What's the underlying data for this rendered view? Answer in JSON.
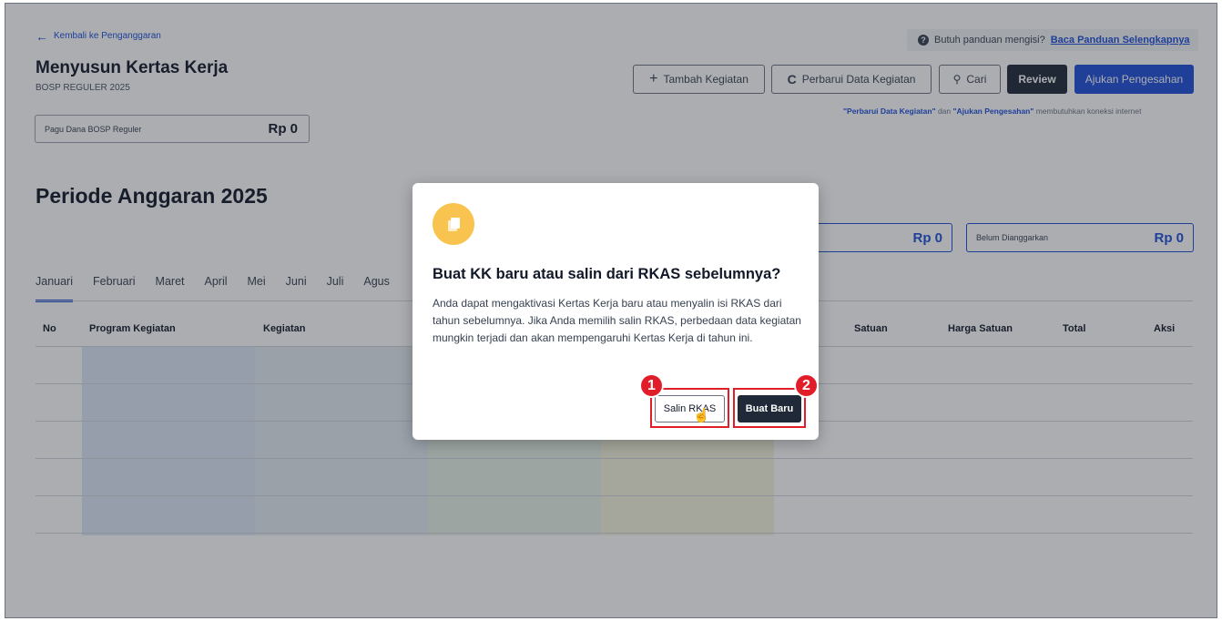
{
  "header": {
    "back_link": "Kembali ke Penganggaran",
    "title": "Menyusun Kertas Kerja",
    "subtitle": "BOSP REGULER 2025",
    "pagu_label": "Pagu Dana BOSP Reguler",
    "pagu_value": "Rp 0",
    "help_text": "Butuh panduan mengisi?",
    "help_link": "Baca Panduan Selengkapnya",
    "note_part1": "\"Perbarui Data Kegiatan\"",
    "note_part2": " dan ",
    "note_part3": "\"Ajukan Pengesahan\"",
    "note_part4": " membutuhkan koneksi internet"
  },
  "toolbar": {
    "tambah": "Tambah Kegiatan",
    "perbarui": "Perbarui Data Kegiatan",
    "cari": "Cari",
    "review": "Review",
    "ajukan": "Ajukan Pengesahan"
  },
  "main": {
    "period_title": "Periode Anggaran 2025",
    "sum_value": "Rp 0",
    "unbudgeted_label": "Belum Dianggarkan",
    "unbudgeted_value": "Rp 0",
    "tabs": [
      "Januari",
      "Februari",
      "Maret",
      "April",
      "Mei",
      "Juni",
      "Juli",
      "Agus"
    ],
    "columns": {
      "no": "No",
      "program": "Program Kegiatan",
      "kegiatan": "Kegiatan",
      "satuan": "Satuan",
      "harga": "Harga Satuan",
      "total": "Total",
      "aksi": "Aksi"
    }
  },
  "modal": {
    "title": "Buat KK baru atau salin dari RKAS sebelumnya?",
    "body": "Anda dapat mengaktivasi Kertas Kerja baru atau menyalin isi RKAS dari tahun sebelumnya. Jika Anda memilih salin RKAS, perbedaan data kegiatan mungkin terjadi dan akan mempengaruhi Kertas Kerja di tahun ini.",
    "salin_button": "Salin RKAS",
    "baru_button": "Buat Baru",
    "annotation_1": "1",
    "annotation_2": "2"
  },
  "colors": {
    "primary": "#1d4ed8",
    "dark": "#1f2937",
    "icon_bg": "#f8c44f",
    "highlight": "#e11d2a"
  }
}
